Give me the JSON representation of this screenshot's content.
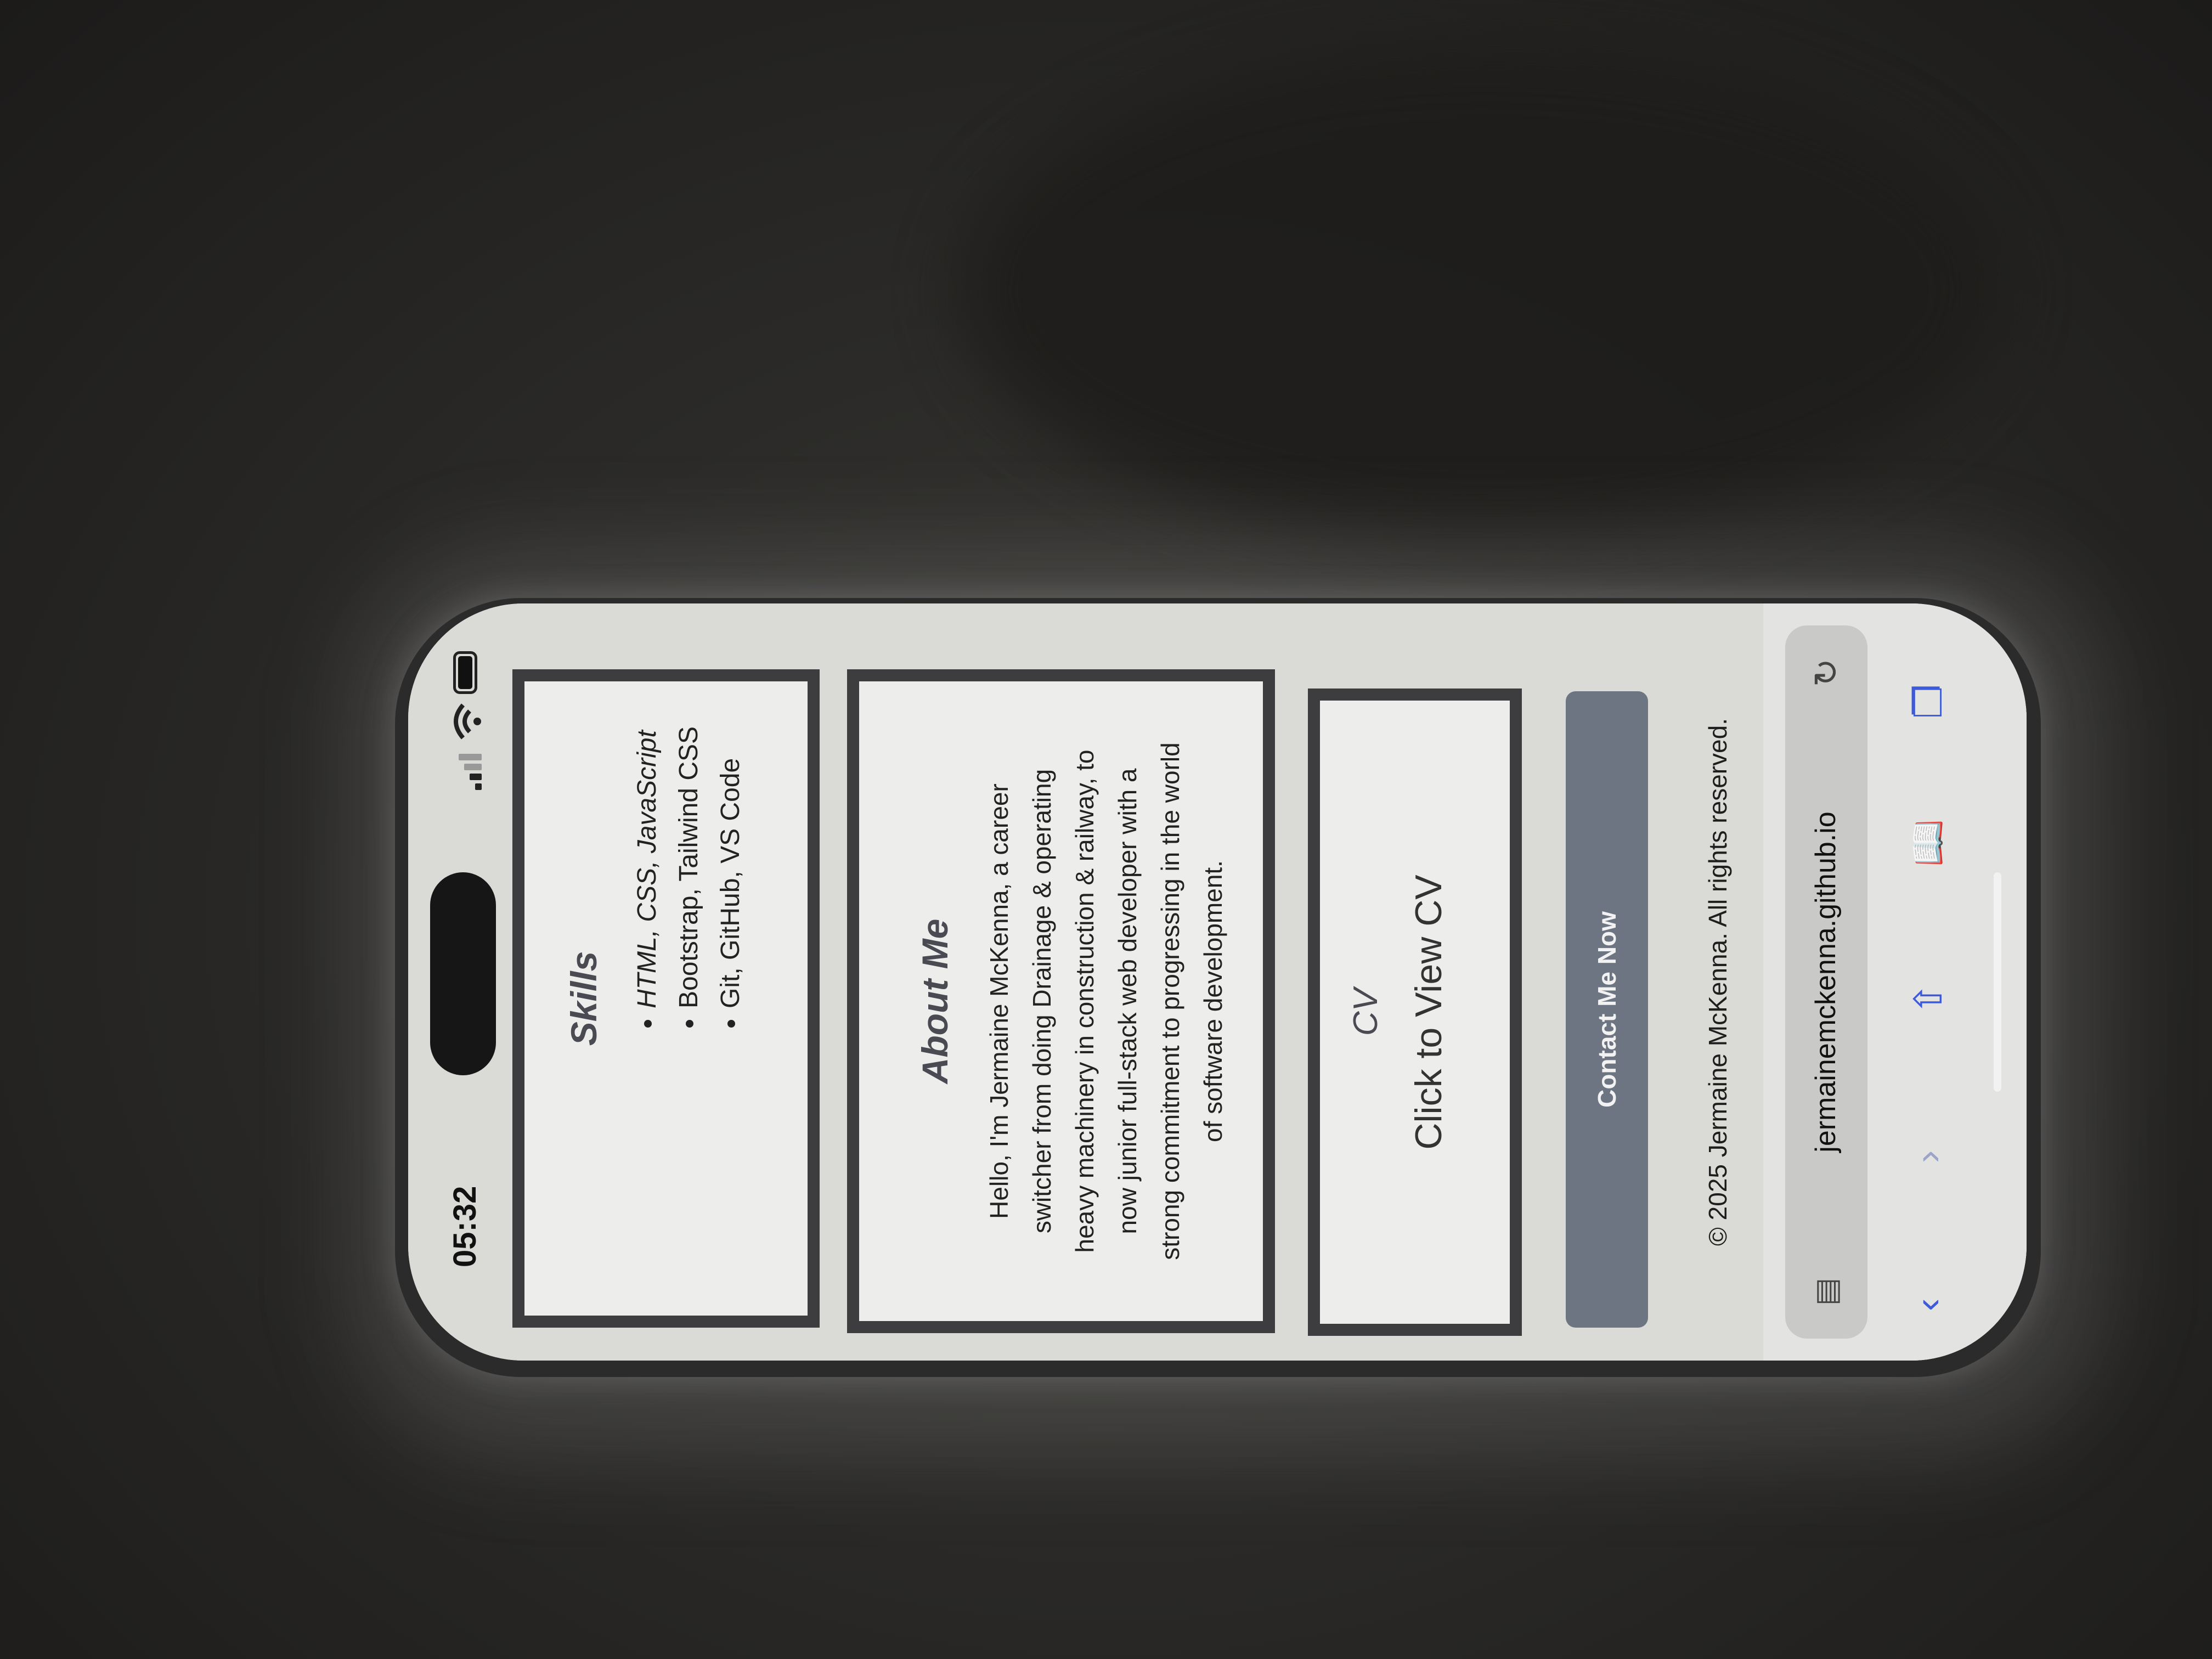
{
  "status": {
    "time": "05:32"
  },
  "skills": {
    "title": "Skills",
    "items": [
      "HTML, CSS, JavaScript",
      "Bootstrap, Tailwind CSS",
      "Git, GitHub, VS Code"
    ]
  },
  "about": {
    "title": "About Me",
    "text": "Hello, I'm Jermaine McKenna, a career switcher from doing Drainage & operating heavy machinery in construction & railway, to now junior full-stack web developer with a strong commitment to progressing in the world of software development."
  },
  "cv": {
    "title": "CV",
    "link": "Click to View CV"
  },
  "contact": {
    "button_label": "Contact Me Now"
  },
  "footer": {
    "text": "© 2025 Jermaine McKenna. All rights reserved."
  },
  "browser": {
    "url": "jermainemckenna.github.io",
    "icons": [
      "page-menu-icon",
      "reload-icon",
      "back-icon",
      "forward-icon",
      "share-icon",
      "bookmarks-icon",
      "tabs-icon"
    ],
    "accent_color": "#3d5bd9"
  }
}
